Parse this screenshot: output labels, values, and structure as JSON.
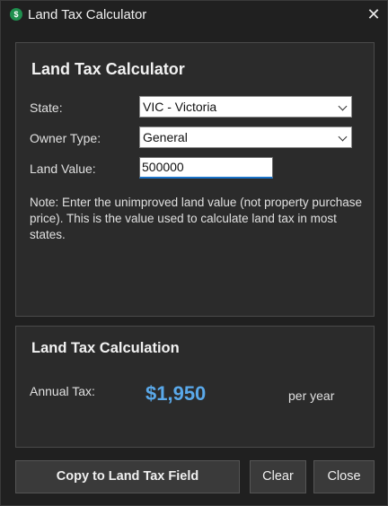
{
  "window": {
    "title": "Land Tax Calculator",
    "app_icon_glyph": "$"
  },
  "form": {
    "heading": "Land Tax Calculator",
    "state_label": "State:",
    "state_value": "VIC - Victoria",
    "owner_type_label": "Owner Type:",
    "owner_type_value": "General",
    "land_value_label": "Land Value:",
    "land_value": "500000",
    "note": "Note: Enter the unimproved land value (not property purchase price). This is the value used to calculate land tax in most states."
  },
  "result": {
    "heading": "Land Tax Calculation",
    "annual_tax_label": "Annual Tax:",
    "annual_tax_amount": "$1,950",
    "per_year": "per year"
  },
  "buttons": {
    "copy": "Copy to Land Tax Field",
    "clear": "Clear",
    "close": "Close"
  },
  "colors": {
    "accent": "#5aa9ea",
    "focus": "#1a73c9",
    "icon": "#1f8f4e"
  },
  "icons": {
    "close": "close-icon",
    "dropdown": "chevron-down-icon"
  }
}
